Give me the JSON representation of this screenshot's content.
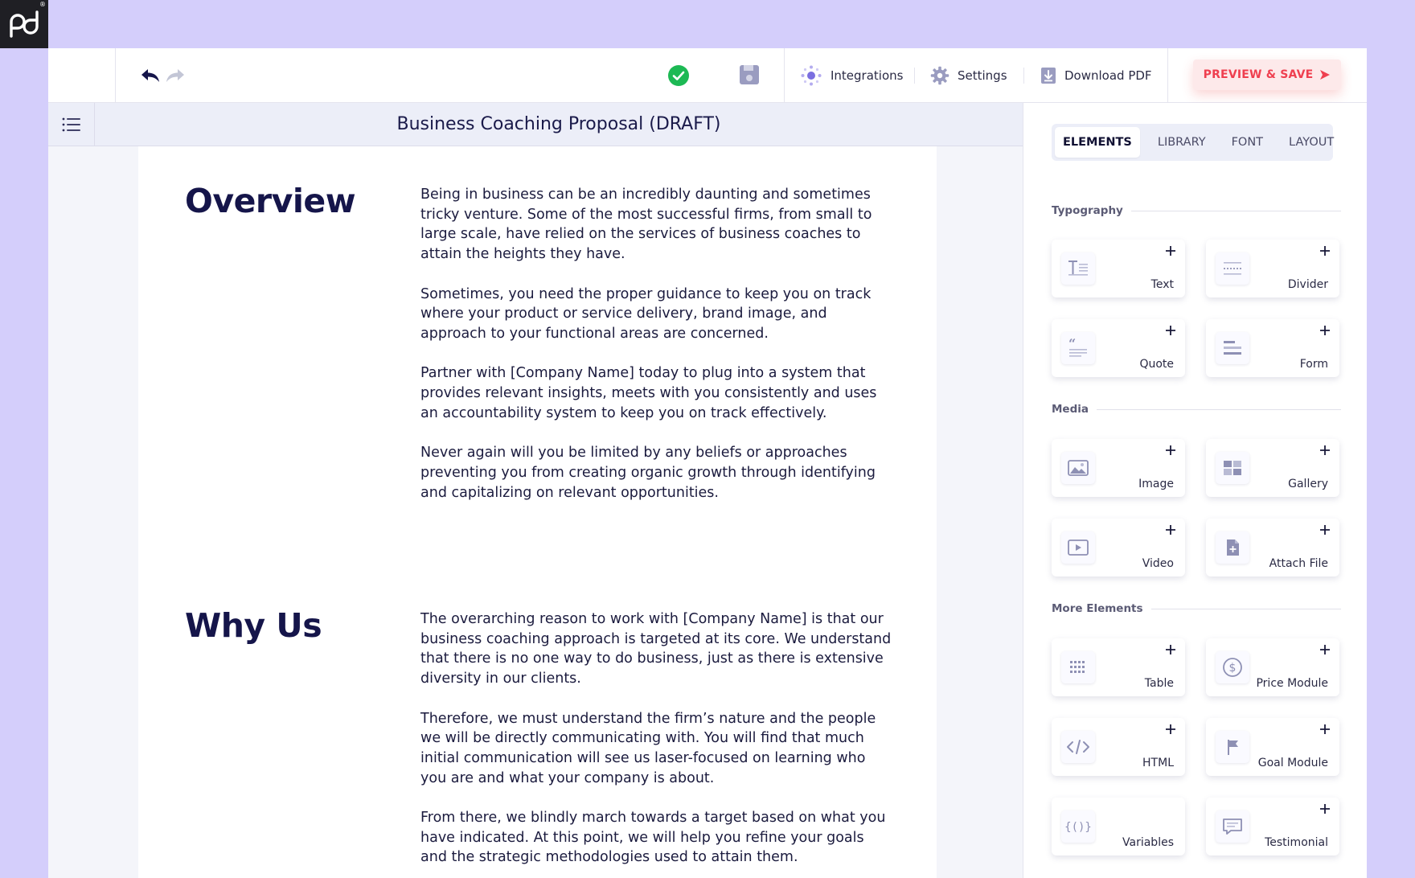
{
  "toolbar": {
    "integrations_label": "Integrations",
    "settings_label": "Settings",
    "download_label": "Download PDF",
    "preview_label": "PREVIEW & SAVE"
  },
  "document": {
    "title": "Business Coaching Proposal (DRAFT)",
    "sections": [
      {
        "heading": "Overview",
        "paragraphs": [
          "Being in business can be an incredibly daunting and sometimes tricky venture. Some of the most successful firms, from small to large scale, have relied on the services of business coaches to attain the heights they have.",
          "Sometimes, you need the proper guidance to keep you on track where your product or service delivery, brand image, and approach to your functional areas are concerned.",
          "Partner with [Company Name] today to plug into a system that provides relevant insights, meets with you consistently and uses an accountability system to keep you on track effectively.",
          "Never again will you be limited by any beliefs or approaches preventing you from creating organic growth through identifying and capitalizing on relevant opportunities."
        ]
      },
      {
        "heading": "Why Us",
        "paragraphs": [
          "The overarching reason to work with [Company Name] is that our business coaching approach is targeted at its core. We understand that there is no one way to do business, just as there is extensive diversity in our clients.",
          "Therefore, we must understand the firm’s nature and the people we will be directly communicating with. You will find that much initial communication will see us laser-focused on learning who you are and what your company is about.",
          "From there, we blindly march towards a target based on what you have indicated. At this point, we will help you refine your goals and the strategic methodologies used to attain them."
        ]
      }
    ]
  },
  "sidebar": {
    "tabs": [
      "ELEMENTS",
      "LIBRARY",
      "FONT",
      "LAYOUT"
    ],
    "active_tab": "ELEMENTS",
    "groups": {
      "typography": "Typography",
      "media": "Media",
      "more": "More Elements"
    },
    "elements": {
      "text": "Text",
      "divider": "Divider",
      "quote": "Quote",
      "form": "Form",
      "image": "Image",
      "gallery": "Gallery",
      "video": "Video",
      "attach_file": "Attach File",
      "table": "Table",
      "price_module": "Price Module",
      "html": "HTML",
      "goal_module": "Goal Module",
      "variables": "Variables",
      "testimonial": "Testimonial"
    }
  },
  "colors": {
    "background": "#d4cefb",
    "accent_red": "#ef3f4f",
    "status_green": "#1db954",
    "heading_navy": "#15154a"
  }
}
